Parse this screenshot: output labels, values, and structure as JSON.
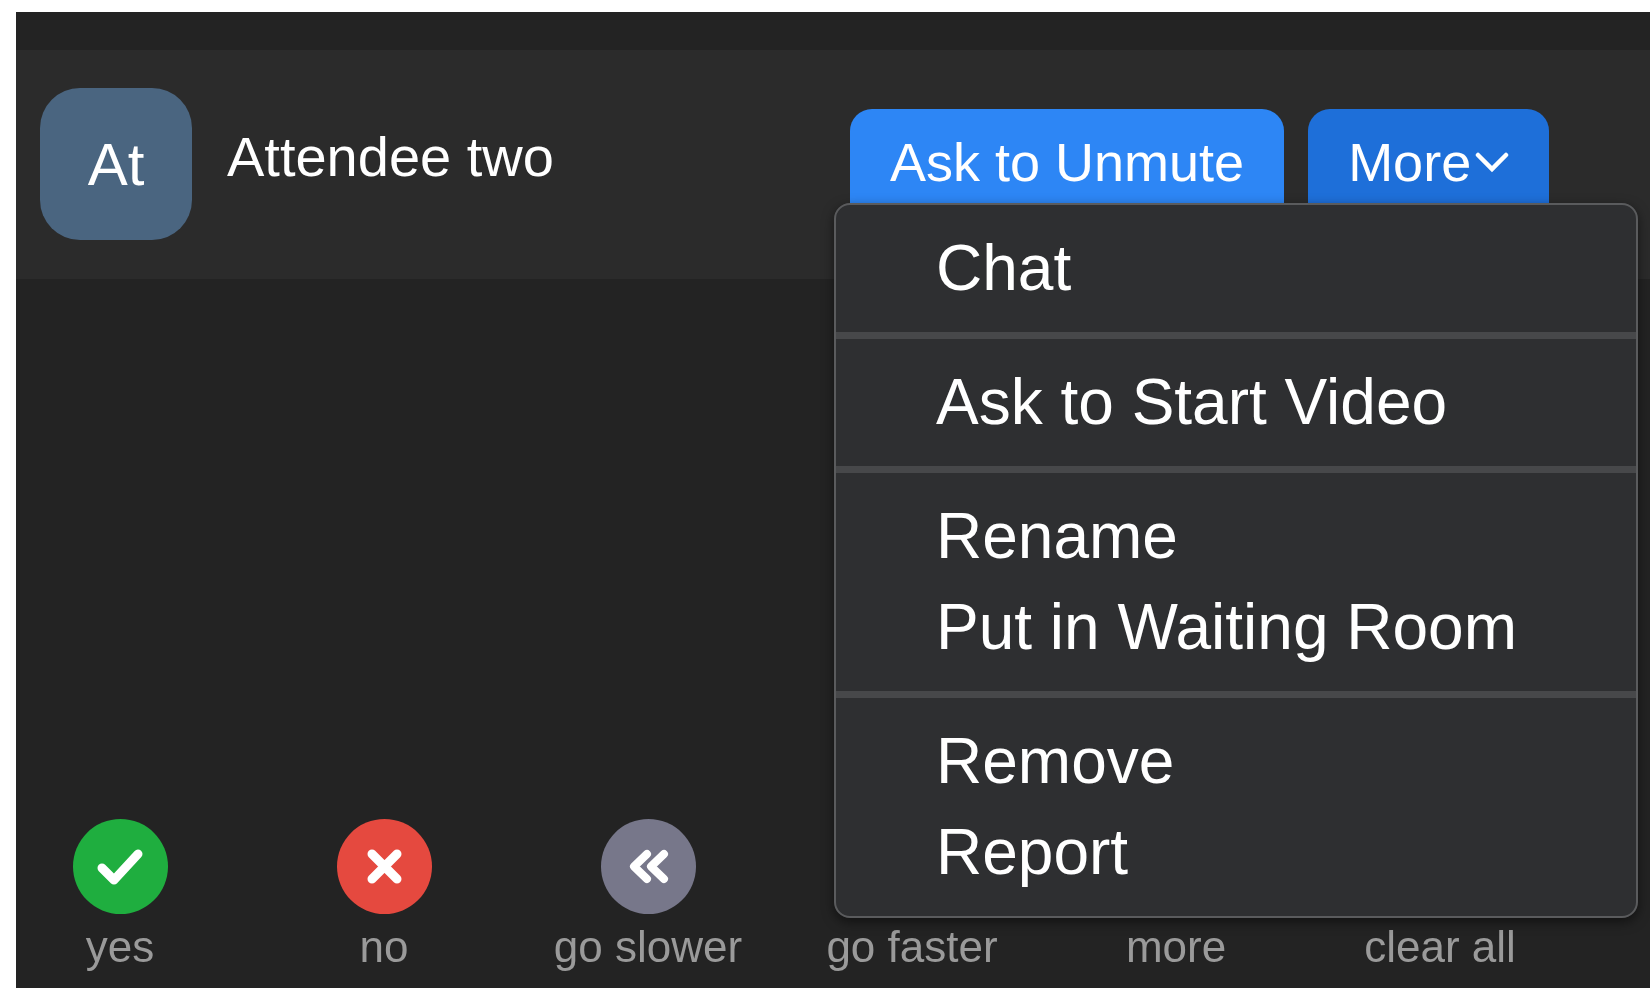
{
  "participant": {
    "initials": "At",
    "name": "Attendee two"
  },
  "buttons": [
    {
      "label": "Ask to Unmute",
      "kind": "primary"
    },
    {
      "label": "More",
      "kind": "dropdown"
    }
  ],
  "menu": {
    "groups": [
      [
        "Chat"
      ],
      [
        "Ask to Start Video"
      ],
      [
        "Rename",
        "Put in Waiting Room"
      ],
      [
        "Remove",
        "Report"
      ]
    ]
  },
  "reactions": [
    {
      "label": "yes",
      "kind": "yes",
      "color": "#1fae3f"
    },
    {
      "label": "no",
      "kind": "no",
      "color": "#e5493f"
    },
    {
      "label": "go slower",
      "kind": "slower",
      "color": "#77778a"
    },
    {
      "label": "go faster",
      "kind": "covered"
    },
    {
      "label": "more",
      "kind": "covered"
    },
    {
      "label": "clear all",
      "kind": "covered"
    }
  ]
}
